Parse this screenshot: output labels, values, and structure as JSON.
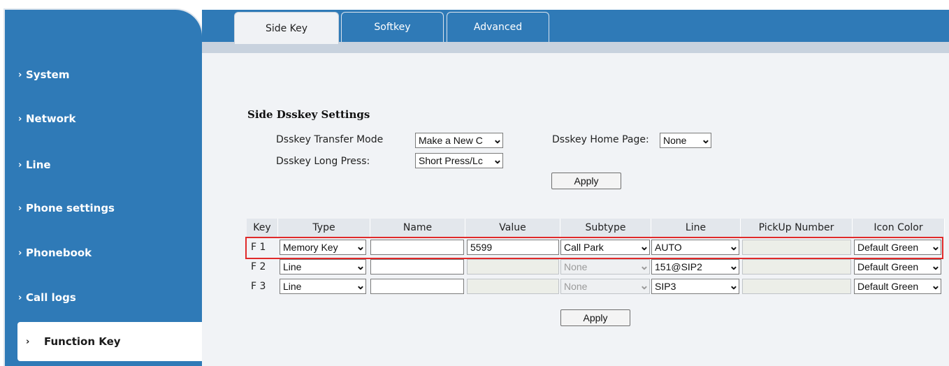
{
  "sidebar": {
    "items": [
      {
        "label": "System"
      },
      {
        "label": "Network"
      },
      {
        "label": "Line"
      },
      {
        "label": "Phone settings"
      },
      {
        "label": "Phonebook"
      },
      {
        "label": "Call logs"
      },
      {
        "label": "Function Key"
      }
    ],
    "chevron": "›"
  },
  "tabs": [
    {
      "label": "Side Key",
      "active": true
    },
    {
      "label": "Softkey",
      "active": false
    },
    {
      "label": "Advanced",
      "active": false
    }
  ],
  "settings": {
    "title": "Side Dsskey Settings",
    "transfer_mode_label": "Dsskey Transfer Mode",
    "transfer_mode_value": "Make a New C",
    "home_page_label": "Dsskey Home Page:",
    "home_page_value": "None",
    "long_press_label": "Dsskey Long Press:",
    "long_press_value": "Short Press/Lc",
    "apply_label": "Apply"
  },
  "table": {
    "headers": [
      "Key",
      "Type",
      "Name",
      "Value",
      "Subtype",
      "Line",
      "PickUp Number",
      "Icon Color"
    ],
    "rows": [
      {
        "key": "F 1",
        "type": "Memory Key",
        "name": "",
        "value": "5599",
        "subtype": "Call Park",
        "line": "AUTO",
        "pickup": "",
        "icon_color": "Default Green"
      },
      {
        "key": "F 2",
        "type": "Line",
        "name": "",
        "value": "",
        "subtype": "None",
        "line": "151@SIP2",
        "pickup": "",
        "icon_color": "Default Green"
      },
      {
        "key": "F 3",
        "type": "Line",
        "name": "",
        "value": "",
        "subtype": "None",
        "line": "SIP3",
        "pickup": "",
        "icon_color": "Default Green"
      }
    ],
    "apply_label": "Apply"
  },
  "icons": {
    "dropdown": "chevron-down-icon",
    "nav": "chevron-right-icon"
  },
  "colors": {
    "sidebar": "#2f7ab7",
    "highlight": "#e02a2a",
    "background": "#f1f3f6"
  }
}
